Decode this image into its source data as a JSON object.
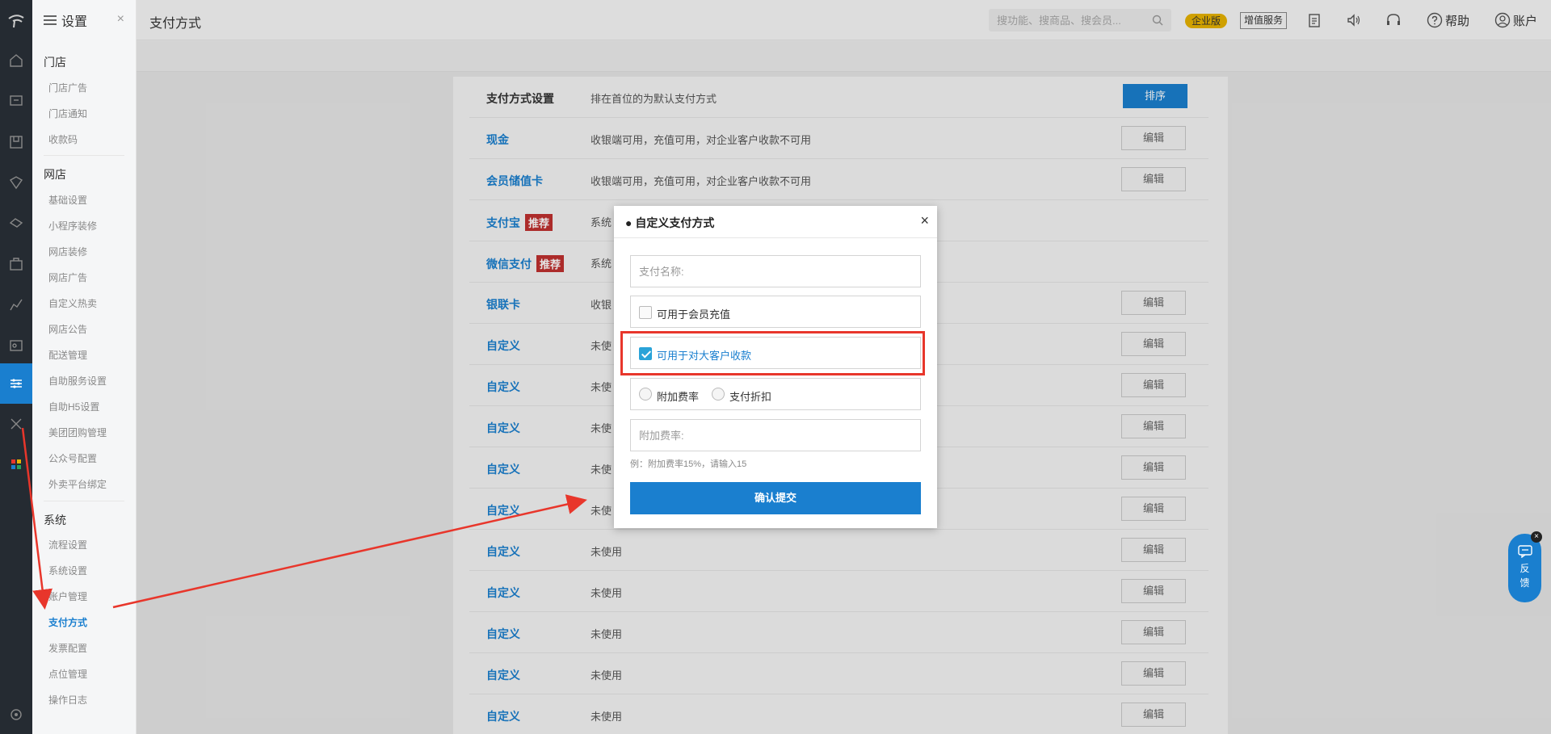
{
  "sidebar": {
    "title": "设置",
    "close": "×",
    "groups": [
      {
        "label": "门店"
      },
      {
        "label": "网店"
      },
      {
        "label": "系统"
      }
    ],
    "store_items": [
      "门店广告",
      "门店通知",
      "收款码"
    ],
    "online_items": [
      "基础设置",
      "小程序装修",
      "网店装修",
      "网店广告",
      "自定义热卖",
      "网店公告",
      "配送管理",
      "自助服务设置",
      "自助H5设置",
      "美团团购管理",
      "公众号配置",
      "外卖平台绑定"
    ],
    "system_items": [
      "流程设置",
      "系统设置",
      "账户管理",
      "支付方式",
      "发票配置",
      "点位管理",
      "操作日志"
    ]
  },
  "topbar": {
    "title": "支付方式",
    "search_placeholder": "搜功能、搜商品、搜会员...",
    "badge_enterprise": "企业版",
    "badge_vas": "增值服务",
    "help": "帮助",
    "account": "账户"
  },
  "table": {
    "header": {
      "name": "支付方式设置",
      "desc": "排在首位的为默认支付方式",
      "button": "排序"
    },
    "rows": [
      {
        "name": "现金",
        "desc": "收银端可用，充值可用，对企业客户收款不可用",
        "button": "编辑"
      },
      {
        "name": "会员储值卡",
        "desc": "收银端可用，充值可用，对企业客户收款不可用",
        "button": "编辑"
      },
      {
        "name": "支付宝",
        "tag": "推荐",
        "desc": "系统"
      },
      {
        "name": "微信支付",
        "tag": "推荐",
        "desc": "系统"
      },
      {
        "name": "银联卡",
        "desc": "收银",
        "button": "编辑"
      },
      {
        "name": "自定义",
        "desc": "未使",
        "button": "编辑"
      },
      {
        "name": "自定义",
        "desc": "未使",
        "button": "编辑"
      },
      {
        "name": "自定义",
        "desc": "未使",
        "button": "编辑"
      },
      {
        "name": "自定义",
        "desc": "未使",
        "button": "编辑"
      },
      {
        "name": "自定义",
        "desc": "未使",
        "button": "编辑"
      },
      {
        "name": "自定义",
        "desc": "未使用",
        "button": "编辑"
      },
      {
        "name": "自定义",
        "desc": "未使用",
        "button": "编辑"
      },
      {
        "name": "自定义",
        "desc": "未使用",
        "button": "编辑"
      },
      {
        "name": "自定义",
        "desc": "未使用",
        "button": "编辑"
      },
      {
        "name": "自定义",
        "desc": "未使用",
        "button": "编辑"
      }
    ]
  },
  "modal": {
    "title": "● 自定义支付方式",
    "close": "×",
    "name_placeholder": "支付名称:",
    "member_recharge": {
      "label": "可用于会员充值",
      "checked": false
    },
    "big_customer": {
      "label": "可用于对大客户收款",
      "checked": true
    },
    "radio_fee": "附加费率",
    "radio_discount": "支付折扣",
    "fee_placeholder": "附加费率:",
    "hint": "例：附加费率15%，请输入15",
    "submit": "确认提交"
  },
  "feedback": {
    "label_1": "反",
    "label_2": "馈",
    "close": "×"
  },
  "colors": {
    "accent": "#1a7fcf",
    "tag": "#c0302f",
    "highlight": "#e8362b",
    "badge": "#e7b300"
  }
}
